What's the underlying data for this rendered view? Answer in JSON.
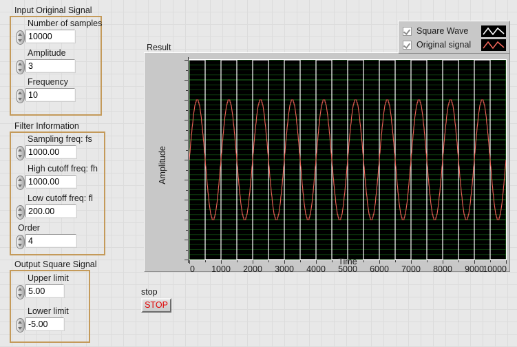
{
  "window": {
    "background": "#e8e8e8"
  },
  "groups": {
    "input_original_signal": {
      "title": "Input Original Signal",
      "controls": [
        {
          "label": "Number of samples",
          "value": "10000",
          "icon": "spinner-icon"
        },
        {
          "label": "Amplitude",
          "value": "3",
          "icon": "spinner-icon"
        },
        {
          "label": "Frequency",
          "value": "10",
          "icon": "spinner-icon"
        }
      ]
    },
    "filter_information": {
      "title": "Filter Information",
      "controls": [
        {
          "label": "Sampling freq: fs",
          "value": "1000.00",
          "icon": "spinner-icon"
        },
        {
          "label": "High cutoff freq: fh",
          "value": "1000.00",
          "icon": "spinner-icon"
        },
        {
          "label": "Low cutoff freq: fl",
          "value": "200.00",
          "icon": "spinner-icon"
        },
        {
          "label": "Order",
          "value": "4",
          "icon": "spinner-icon"
        }
      ]
    },
    "output_square_signal": {
      "title": "Output Square Signal",
      "controls": [
        {
          "label": "Upper limit",
          "value": "5.00",
          "icon": "spinner-icon"
        },
        {
          "label": "Lower limit",
          "value": "-5.00",
          "icon": "spinner-icon"
        }
      ]
    }
  },
  "stop": {
    "label": "stop",
    "button_label": "STOP",
    "button_color": "#e00000"
  },
  "graph": {
    "label": "Result",
    "legend": {
      "items": [
        {
          "label": "Square Wave",
          "checked": true,
          "color": "#ffffff"
        },
        {
          "label": "Original signal",
          "checked": true,
          "color": "#f06458"
        }
      ]
    }
  },
  "chart_data": {
    "type": "line",
    "title": "Result",
    "xlabel": "Time",
    "ylabel": "Amplitude",
    "xlim": [
      0,
      10000
    ],
    "ylim": [
      -5,
      5
    ],
    "xticks": [
      0,
      1000,
      2000,
      3000,
      4000,
      5000,
      6000,
      7000,
      8000,
      9000,
      10000
    ],
    "yticks": [
      5,
      4,
      3,
      2,
      1,
      0,
      -1,
      -2,
      -3,
      -4,
      -5
    ],
    "x_minor_per_major": 2,
    "y_minor_per_major": 4,
    "grid": true,
    "grid_color": "#1e7a1e",
    "grid_minor_color": "#0d3d0d",
    "plot_background": "#000000",
    "legend_position": "outside-top-right",
    "series": [
      {
        "name": "Square Wave",
        "type": "square",
        "color": "#ffffff",
        "amplitude_high": 5,
        "amplitude_low": -5,
        "cycles": 10,
        "duty": 0.5,
        "phase": 0
      },
      {
        "name": "Original signal",
        "type": "sine",
        "color": "#f06458",
        "amplitude": 3,
        "cycles": 10,
        "phase": 0,
        "quantization_steps": 24
      }
    ],
    "samples": 10000
  }
}
